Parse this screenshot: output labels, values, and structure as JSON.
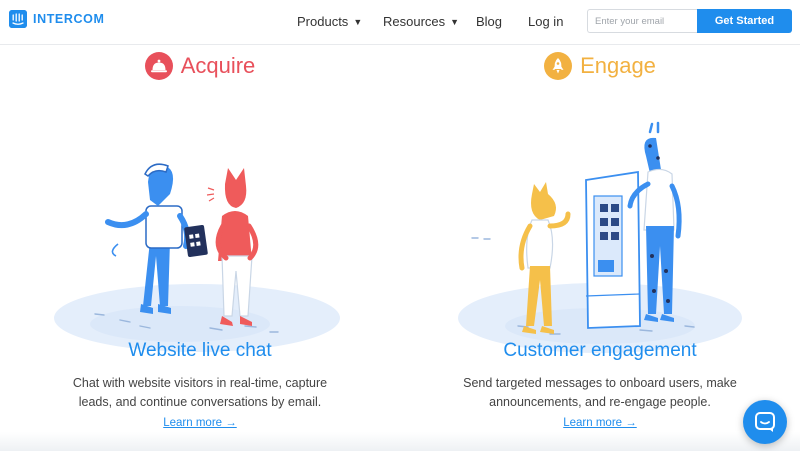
{
  "nav": {
    "logo_text": "INTERCOM",
    "links": [
      {
        "label": "Products",
        "has_dropdown": true
      },
      {
        "label": "Resources",
        "has_dropdown": true
      },
      {
        "label": "Blog",
        "has_dropdown": false
      },
      {
        "label": "Log in",
        "has_dropdown": false
      }
    ],
    "email_placeholder": "Enter your email",
    "email_value": "",
    "cta_label": "Get Started"
  },
  "sections": [
    {
      "heading": "Acquire",
      "icon": "service-bell-icon",
      "accent": "#e8505b",
      "title": "Website live chat",
      "description": "Chat with website visitors in real-time, capture leads, and continue conversations by email.",
      "link": "Learn more →"
    },
    {
      "heading": "Engage",
      "icon": "rocket-icon",
      "accent": "#f2b141",
      "title": "Customer engagement",
      "description": "Send targeted messages to onboard users, make announcements, and re-engage people.",
      "link": "Learn more →"
    }
  ],
  "colors": {
    "brand": "#1f8ded",
    "acquire_accent": "#e8505b",
    "engage_accent": "#f2b141",
    "illustration_blue": "#3b8ff0",
    "illustration_red": "#ef5b5b",
    "illustration_yellow": "#f5c04a"
  },
  "messenger_icon": "chat-bubble-icon"
}
